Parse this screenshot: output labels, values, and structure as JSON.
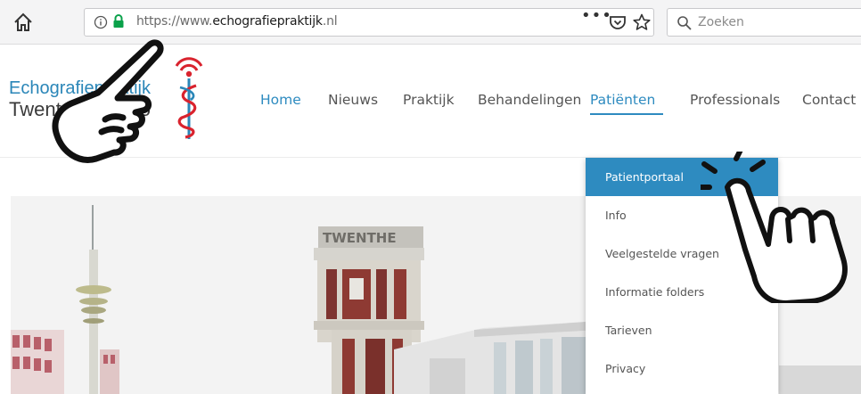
{
  "browser": {
    "url_prefix": "https://www.",
    "url_domain": "echografiepraktijk",
    "url_suffix": ".nl",
    "page_actions": "•••",
    "search_placeholder": "Zoeken",
    "icons": [
      "home-icon",
      "info-icon",
      "lock-icon",
      "pocket-icon",
      "star-icon",
      "search-icon"
    ],
    "lock_color": "#0aa14a"
  },
  "site": {
    "logo": {
      "line1": "Echografiepraktijk",
      "line2": "Twente Hengelo",
      "brand_color": "#2a86b8",
      "emblem_red": "#d9232e"
    },
    "nav": [
      {
        "label": "Home",
        "state": "active"
      },
      {
        "label": "Nieuws",
        "state": ""
      },
      {
        "label": "Praktijk",
        "state": ""
      },
      {
        "label": "Behandelingen",
        "state": ""
      },
      {
        "label": "Patiënten",
        "state": "open"
      },
      {
        "label": "Professionals",
        "state": ""
      },
      {
        "label": "Contact &",
        "state": ""
      }
    ],
    "accent_color": "#2e8bc0"
  },
  "dropdown": {
    "items": [
      {
        "label": "Patientportaal",
        "active": true
      },
      {
        "label": "Info",
        "active": false
      },
      {
        "label": "Veelgestelde vragen",
        "active": false
      },
      {
        "label": "Informatie folders",
        "active": false
      },
      {
        "label": "Tarieven",
        "active": false
      },
      {
        "label": "Privacy",
        "active": false
      }
    ]
  },
  "hero": {
    "sign_text": "TWENTHE"
  },
  "overlay": {
    "left_hand": "pointing-hand-icon",
    "right_hand": "pointing-hand-icon"
  }
}
